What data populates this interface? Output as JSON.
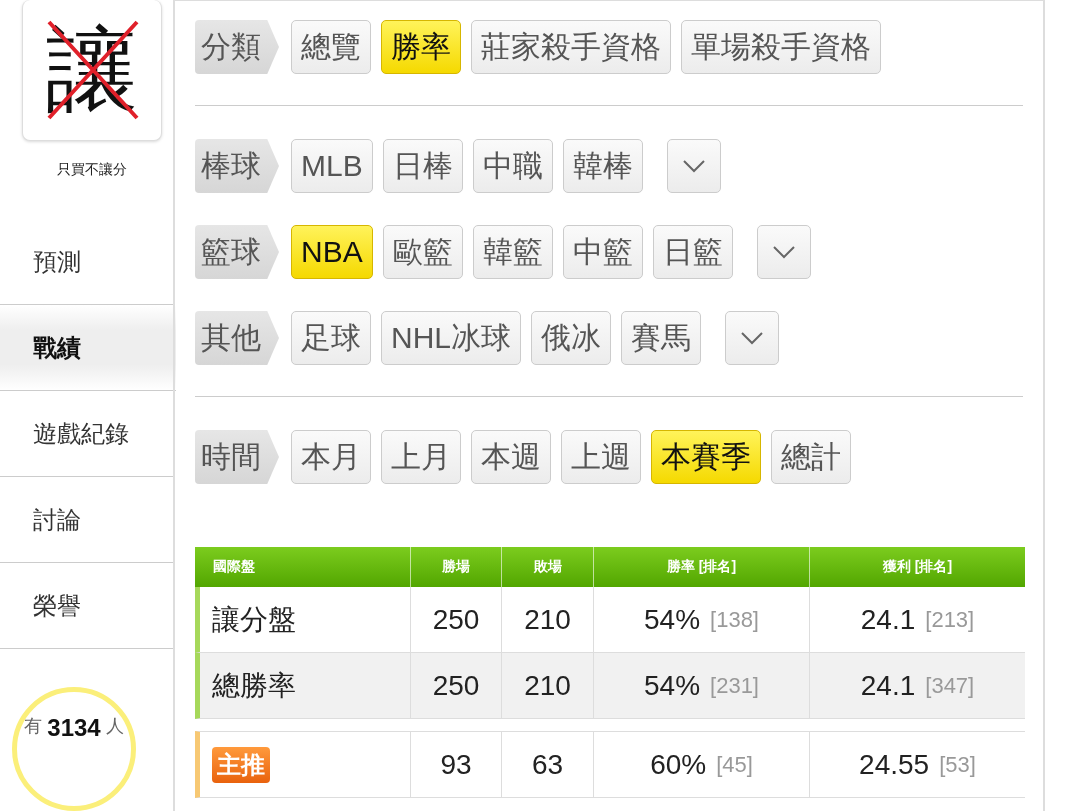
{
  "sidebar": {
    "logo": {
      "character": "讓",
      "caption": "只買不讓分"
    },
    "items": [
      {
        "label": "預測",
        "selected": false
      },
      {
        "label": "戰績",
        "selected": true
      },
      {
        "label": "遊戲紀錄",
        "selected": false
      },
      {
        "label": "討論",
        "selected": false
      },
      {
        "label": "榮譽",
        "selected": false
      }
    ],
    "online": {
      "prefix": "有",
      "count": "3134",
      "suffix": "人"
    }
  },
  "filter_groups": [
    {
      "rows": [
        {
          "label": "分類",
          "more": false,
          "options": [
            {
              "label": "總覽",
              "selected": false
            },
            {
              "label": "勝率",
              "selected": true
            },
            {
              "label": "莊家殺手資格",
              "selected": false
            },
            {
              "label": "單場殺手資格",
              "selected": false
            }
          ]
        }
      ]
    },
    {
      "rows": [
        {
          "label": "棒球",
          "more": true,
          "options": [
            {
              "label": "MLB",
              "selected": false
            },
            {
              "label": "日棒",
              "selected": false
            },
            {
              "label": "中職",
              "selected": false
            },
            {
              "label": "韓棒",
              "selected": false
            }
          ]
        },
        {
          "label": "籃球",
          "more": true,
          "options": [
            {
              "label": "NBA",
              "selected": true
            },
            {
              "label": "歐籃",
              "selected": false
            },
            {
              "label": "韓籃",
              "selected": false
            },
            {
              "label": "中籃",
              "selected": false
            },
            {
              "label": "日籃",
              "selected": false
            }
          ]
        },
        {
          "label": "其他",
          "more": true,
          "options": [
            {
              "label": "足球",
              "selected": false
            },
            {
              "label": "NHL冰球",
              "selected": false
            },
            {
              "label": "俄冰",
              "selected": false
            },
            {
              "label": "賽馬",
              "selected": false
            }
          ]
        }
      ]
    },
    {
      "rows": [
        {
          "label": "時間",
          "more": false,
          "options": [
            {
              "label": "本月",
              "selected": false
            },
            {
              "label": "上月",
              "selected": false
            },
            {
              "label": "本週",
              "selected": false
            },
            {
              "label": "上週",
              "selected": false
            },
            {
              "label": "本賽季",
              "selected": true
            },
            {
              "label": "總計",
              "selected": false
            }
          ]
        }
      ]
    }
  ],
  "table": {
    "columns": [
      "國際盤",
      "勝場",
      "敗場",
      "勝率 [排名]",
      "獲利 [排名]"
    ],
    "rows": [
      {
        "kind": "stat",
        "name": "讓分盤",
        "wins": "250",
        "losses": "210",
        "rate": "54%",
        "rate_rank": "[138]",
        "profit": "24.1",
        "profit_rank": "[213]"
      },
      {
        "kind": "stat",
        "name": "總勝率",
        "wins": "250",
        "losses": "210",
        "rate": "54%",
        "rate_rank": "[231]",
        "profit": "24.1",
        "profit_rank": "[347]"
      },
      {
        "kind": "featured",
        "name": "主推",
        "wins": "93",
        "losses": "63",
        "rate": "60%",
        "rate_rank": "[45]",
        "profit": "24.55",
        "profit_rank": "[53]"
      }
    ]
  }
}
